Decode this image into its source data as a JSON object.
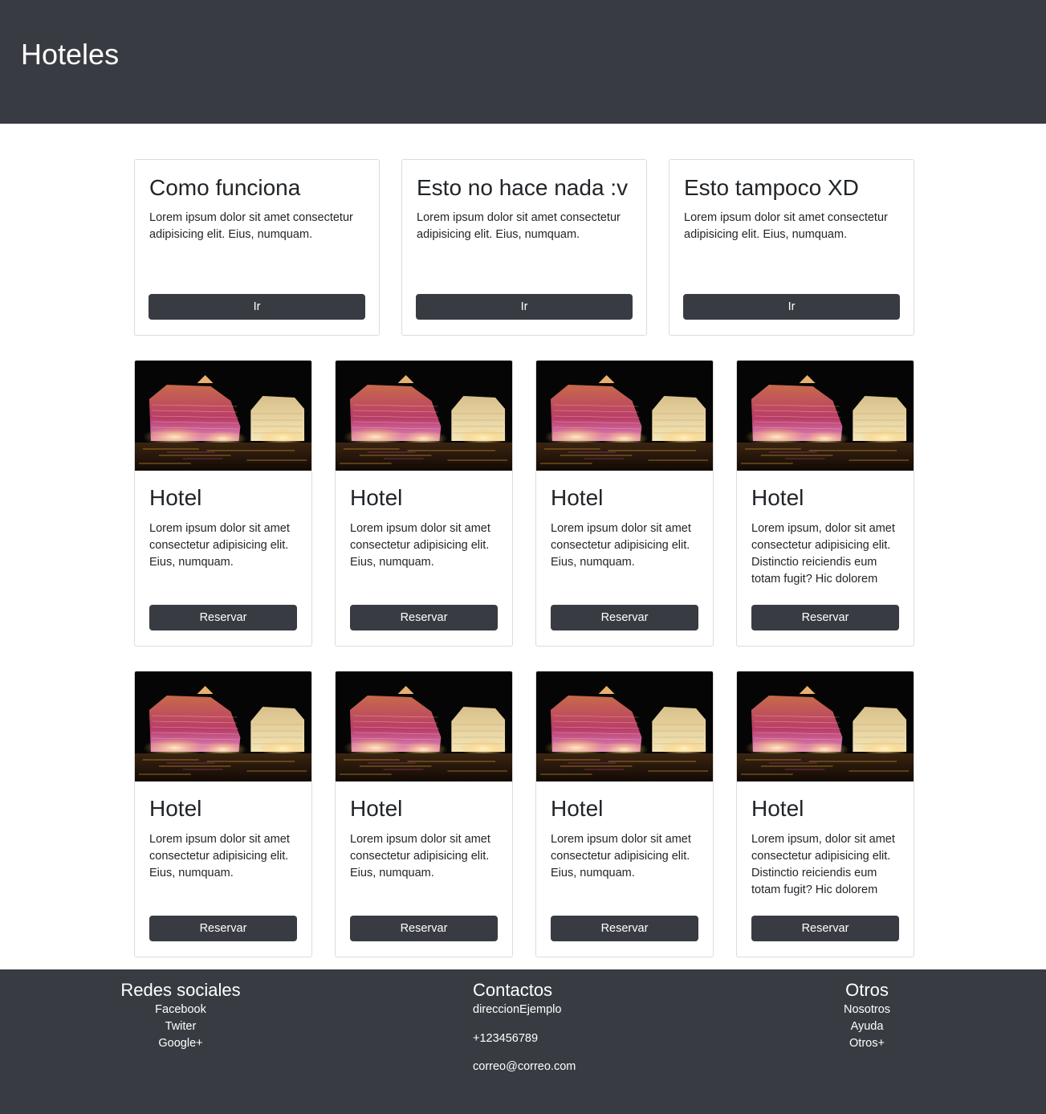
{
  "header": {
    "title": "Hoteles"
  },
  "features": [
    {
      "title": "Como funciona",
      "text": "Lorem ipsum dolor sit amet consectetur adipisicing elit. Eius, numquam.",
      "button": "Ir"
    },
    {
      "title": "Esto no hace nada :v",
      "text": "Lorem ipsum dolor sit amet consectetur adipisicing elit. Eius, numquam.",
      "button": "Ir"
    },
    {
      "title": "Esto tampoco XD",
      "text": "Lorem ipsum dolor sit amet consectetur adipisicing elit. Eius, numquam.",
      "button": "Ir"
    }
  ],
  "hotels": [
    {
      "title": "Hotel",
      "text": "Lorem ipsum dolor sit amet consectetur adipisicing elit. Eius, numquam.",
      "button": "Reservar"
    },
    {
      "title": "Hotel",
      "text": "Lorem ipsum dolor sit amet consectetur adipisicing elit. Eius, numquam.",
      "button": "Reservar"
    },
    {
      "title": "Hotel",
      "text": "Lorem ipsum dolor sit amet consectetur adipisicing elit. Eius, numquam.",
      "button": "Reservar"
    },
    {
      "title": "Hotel",
      "text": "Lorem ipsum, dolor sit amet consectetur adipisicing elit. Distinctio reiciendis eum totam fugit? Hic dolorem",
      "button": "Reservar"
    },
    {
      "title": "Hotel",
      "text": "Lorem ipsum dolor sit amet consectetur adipisicing elit. Eius, numquam.",
      "button": "Reservar"
    },
    {
      "title": "Hotel",
      "text": "Lorem ipsum dolor sit amet consectetur adipisicing elit. Eius, numquam.",
      "button": "Reservar"
    },
    {
      "title": "Hotel",
      "text": "Lorem ipsum dolor sit amet consectetur adipisicing elit. Eius, numquam.",
      "button": "Reservar"
    },
    {
      "title": "Hotel",
      "text": "Lorem ipsum, dolor sit amet consectetur adipisicing elit. Distinctio reiciendis eum totam fugit? Hic dolorem",
      "button": "Reservar"
    }
  ],
  "footer": {
    "social": {
      "title": "Redes sociales",
      "links": [
        "Facebook",
        "Twiter",
        "Google+"
      ]
    },
    "contacts": {
      "title": "Contactos",
      "items": [
        "direccionEjemplo",
        "+123456789",
        "correo@correo.com"
      ]
    },
    "others": {
      "title": "Otros",
      "links": [
        "Nosotros",
        "Ayuda",
        "Otros+"
      ]
    }
  },
  "colors": {
    "dark": "#383c42",
    "border": "#dcdcdc"
  }
}
